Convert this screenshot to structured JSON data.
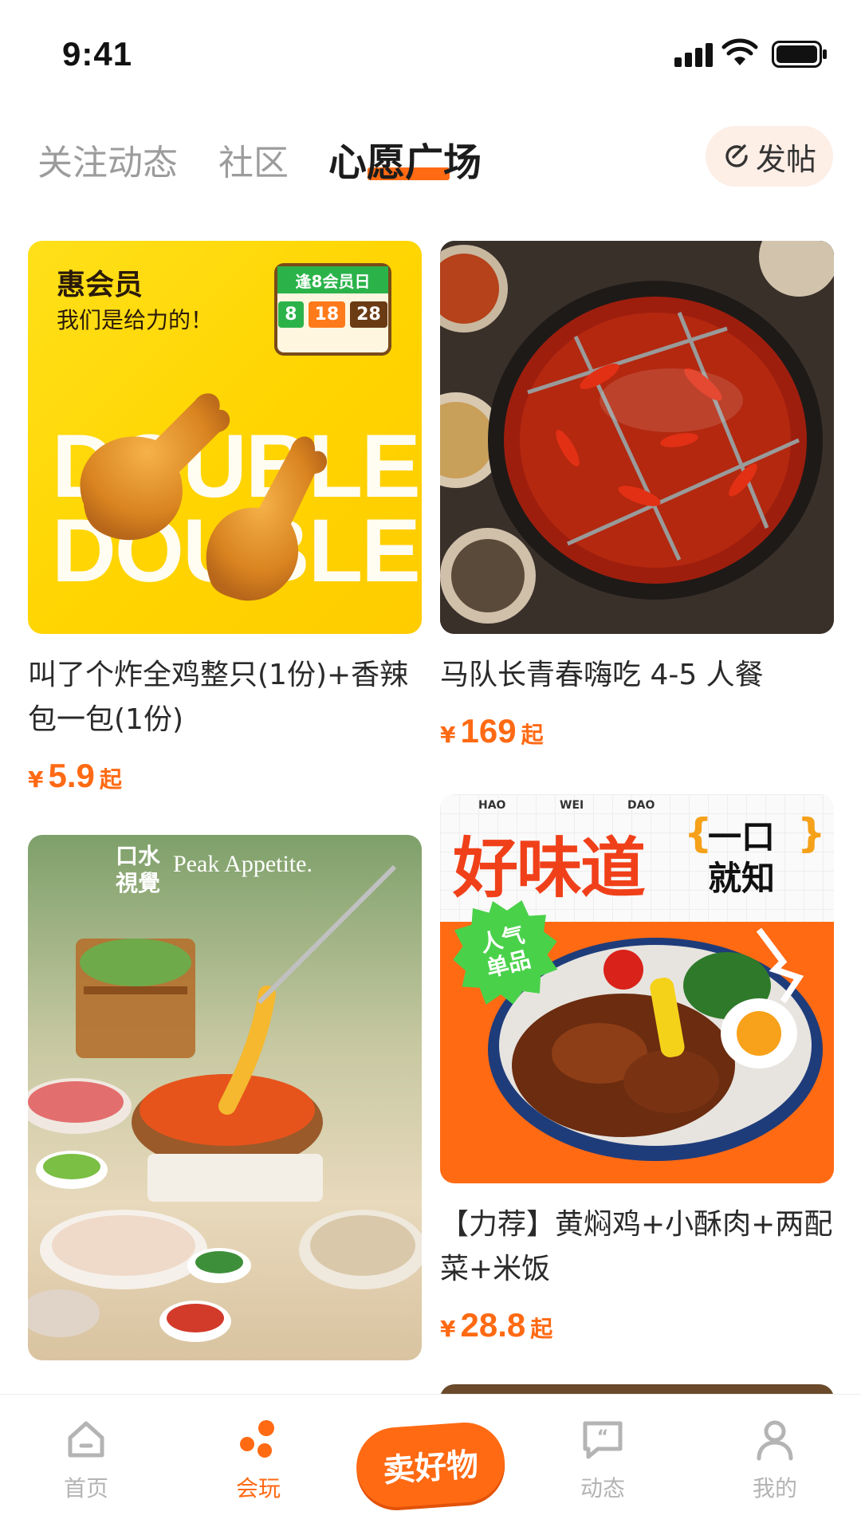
{
  "status_bar": {
    "time": "9:41"
  },
  "top_tabs": [
    {
      "label": "关注动态"
    },
    {
      "label": "社区"
    },
    {
      "label": "心愿广场"
    }
  ],
  "post_button": {
    "label": "发帖",
    "icon": "edit-icon"
  },
  "accent_color": "#ff6a13",
  "feed": [
    {
      "title": "叫了个炸全鸡整只(1份)+香辣包一包(1份)",
      "price_symbol": "¥",
      "price": "5.9",
      "price_suffix": "起",
      "image": {
        "heading": "惠会员",
        "subheading": "我们是给力的！",
        "badge_top": "逢8会员日",
        "badge_dates": [
          "8",
          "18",
          "28"
        ],
        "big_text": [
          "DOUBLE",
          "DOUBLE"
        ]
      }
    },
    {
      "title": "马队长青春嗨吃 4-5 人餐",
      "price_symbol": "¥",
      "price": "169",
      "price_suffix": "起",
      "image": {}
    },
    {
      "title": "",
      "price_symbol": "",
      "price": "",
      "price_suffix": "",
      "image": {
        "brand_cn": "口水視覺",
        "brand_en": "Peak Appetite."
      }
    },
    {
      "title": "【力荐】黄焖鸡+小酥肉+两配菜+米饭",
      "price_symbol": "¥",
      "price": "28.8",
      "price_suffix": "起",
      "image": {
        "pinyin": [
          "HAO",
          "WEI",
          "DAO"
        ],
        "heading": "好味道",
        "bracket_text": [
          "一口",
          "就知"
        ],
        "sticker": [
          "人气",
          "单品"
        ]
      }
    }
  ],
  "bottom_nav": [
    {
      "label": "首页",
      "icon": "home-icon"
    },
    {
      "label": "会玩",
      "icon": "dots-icon"
    },
    {
      "label": "卖好物",
      "icon": ""
    },
    {
      "label": "动态",
      "icon": "chat-quote-icon"
    },
    {
      "label": "我的",
      "icon": "user-icon"
    }
  ]
}
